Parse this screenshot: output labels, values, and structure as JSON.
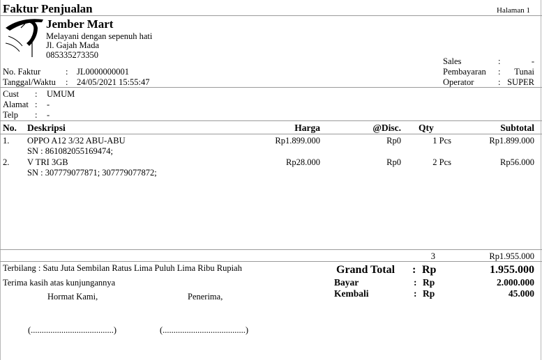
{
  "header": {
    "title": "Faktur  Penjualan",
    "page": "Halaman 1"
  },
  "store": {
    "name": "Jember  Mart",
    "tagline": "Melayani  dengan  sepenuh  hati",
    "address": "Jl.  Gajah  Mada",
    "phone": "085335273350"
  },
  "info_right": [
    {
      "label": "Sales",
      "sep": ":",
      "value": "-"
    },
    {
      "label": "Pembayaran",
      "sep": ":",
      "value": "Tunai"
    },
    {
      "label": "Operator",
      "sep": ":",
      "value": "SUPER"
    }
  ],
  "invoice": {
    "no_label": "No.  Faktur",
    "no_sep": ":",
    "no_value": "JL0000000001",
    "date_label": "Tanggal/Waktu",
    "date_sep": ":",
    "date_value": "24/05/2021  15:55:47"
  },
  "customer": [
    {
      "label": "Cust",
      "sep": ":",
      "value": "UMUM"
    },
    {
      "label": "Alamat",
      "sep": ":",
      "value": "-"
    },
    {
      "label": "Telp",
      "sep": ":",
      "value": "-"
    }
  ],
  "table": {
    "headers": {
      "no": "No.",
      "desc": "Deskripsi",
      "price": "Harga",
      "disc": "@Disc.",
      "qty": "Qty",
      "subtotal": "Subtotal"
    },
    "rows": [
      {
        "no": "1.",
        "desc": "OPPO  A12  3/32  ABU-ABU",
        "sn": "SN  :  861082055169474;",
        "price": "Rp1.899.000",
        "disc": "Rp0",
        "qty": "1  Pcs",
        "subtotal": "Rp1.899.000"
      },
      {
        "no": "2.",
        "desc": "V  TRI  3GB",
        "sn": "SN  :  307779077871;  307779077872;",
        "price": "Rp28.000",
        "disc": "Rp0",
        "qty": "2  Pcs",
        "subtotal": "Rp56.000"
      }
    ],
    "total_qty": "3",
    "total_subtotal": "Rp1.955.000"
  },
  "footer": {
    "terbilang": "Terbilang  :  Satu  Juta  Sembilan  Ratus  Lima  Puluh  Lima  Ribu   Rupiah",
    "thanks": "Terima  kasih  atas  kunjungannya",
    "hormat": "Hormat  Kami,",
    "penerima": "Penerima,",
    "sign_left": "(......................................)",
    "sign_right": "(......................................)"
  },
  "totals": [
    {
      "label": "Grand  Total",
      "sep": ":",
      "cur": "Rp",
      "value": "1.955.000"
    },
    {
      "label": "Bayar",
      "sep": ":",
      "cur": "Rp",
      "value": "2.000.000"
    },
    {
      "label": "Kembali",
      "sep": ":",
      "cur": "Rp",
      "value": "45.000"
    }
  ]
}
